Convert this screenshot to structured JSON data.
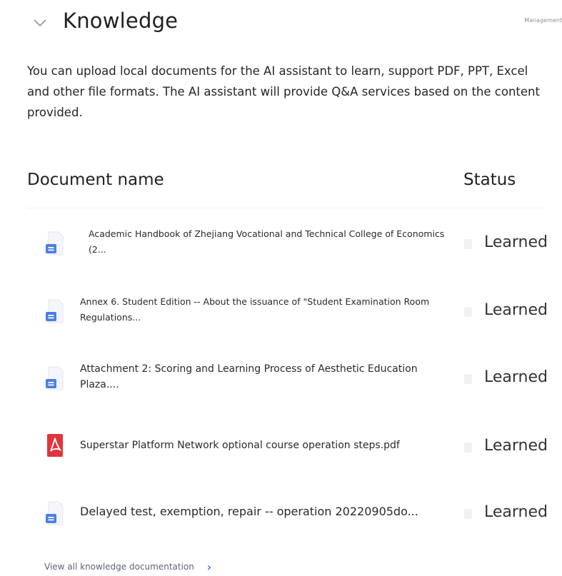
{
  "header": {
    "title": "Knowledge",
    "manage_label": "Management"
  },
  "description": "You can upload local documents for the AI assistant to learn, support PDF, PPT, Excel and other file formats. The AI assistant will provide Q&A services based on the content provided.",
  "table": {
    "col_name": "Document name",
    "col_status": "Status",
    "rows": [
      {
        "name": "Academic Handbook of Zhejiang Vocational and Technical College of Economics (2...",
        "type": "doc-icon",
        "status": "Learned"
      },
      {
        "name": "Annex 6. Student Edition -- About the issuance of \"Student Examination Room Regulations...",
        "type": "doc-icon",
        "status": "Learned"
      },
      {
        "name": "Attachment 2: Scoring and Learning Process of Aesthetic Education Plaza....",
        "type": "doc-icon",
        "status": "Learned"
      },
      {
        "name": "Superstar Platform Network optional course operation steps.pdf",
        "type": "pdf-icon",
        "status": "Learned"
      },
      {
        "name": "Delayed test, exemption, repair -- operation 20220905do...",
        "type": "doc-icon",
        "status": "Learned"
      }
    ]
  },
  "footer": {
    "view_all": "View all knowledge documentation",
    "arrow_icon": "chevron-right-icon"
  },
  "colors": {
    "doc_icon_blue": "#4a7ee6",
    "pdf_icon_red": "#e2343e",
    "link_blue": "#1e4fc9"
  }
}
